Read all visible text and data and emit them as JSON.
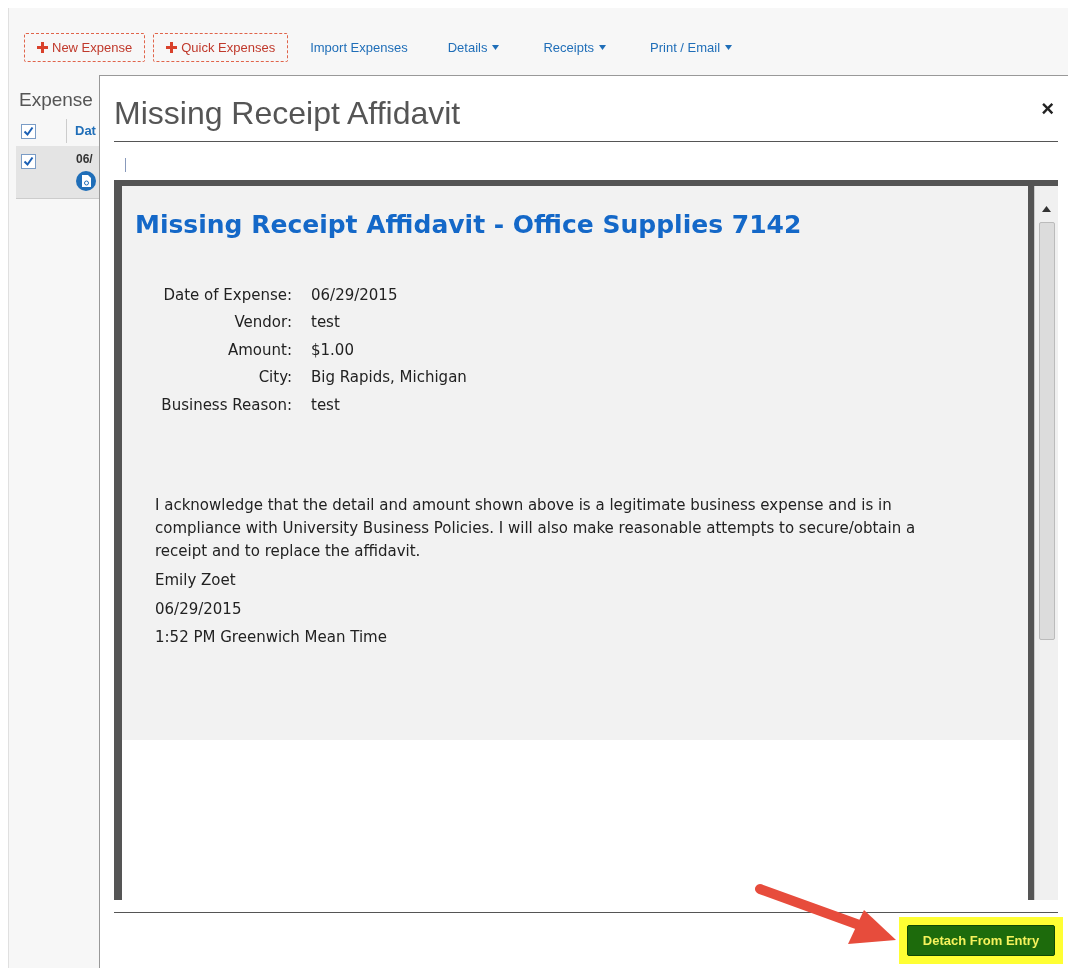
{
  "toolbar": [
    {
      "label": "New Expense",
      "kind": "add"
    },
    {
      "label": "Quick Expenses",
      "kind": "add"
    },
    {
      "label": "Import Expenses",
      "kind": "link"
    },
    {
      "label": "Details",
      "kind": "menu"
    },
    {
      "label": "Receipts",
      "kind": "menu"
    },
    {
      "label": "Print / Email",
      "kind": "menu"
    }
  ],
  "expense_list": {
    "title": "Expense",
    "header": {
      "checked": true,
      "column_1": "Dat"
    },
    "rows": [
      {
        "checked": true,
        "selected": true,
        "date": "06/"
      }
    ]
  },
  "dialog": {
    "title": "Missing Receipt Affidavit",
    "close": "×",
    "document": {
      "heading": "Missing Receipt Affidavit - Office Supplies 7142",
      "fields": [
        {
          "label": "Date of Expense:",
          "value": "06/29/2015"
        },
        {
          "label": "Vendor:",
          "value": "test"
        },
        {
          "label": "Amount:",
          "value": "$1.00"
        },
        {
          "label": "City:",
          "value": "Big Rapids, Michigan"
        },
        {
          "label": "Business Reason:",
          "value": "test"
        }
      ],
      "statement": "I acknowledge that the detail and amount shown above is a legitimate business expense and is in compliance with University Business Policies. I will also make reasonable attempts to secure/obtain a receipt and to replace the affidavit.",
      "signature": [
        "Emily Zoet",
        "06/29/2015",
        "1:52 PM Greenwich Mean Time"
      ]
    },
    "button": "Detach From Entry"
  }
}
